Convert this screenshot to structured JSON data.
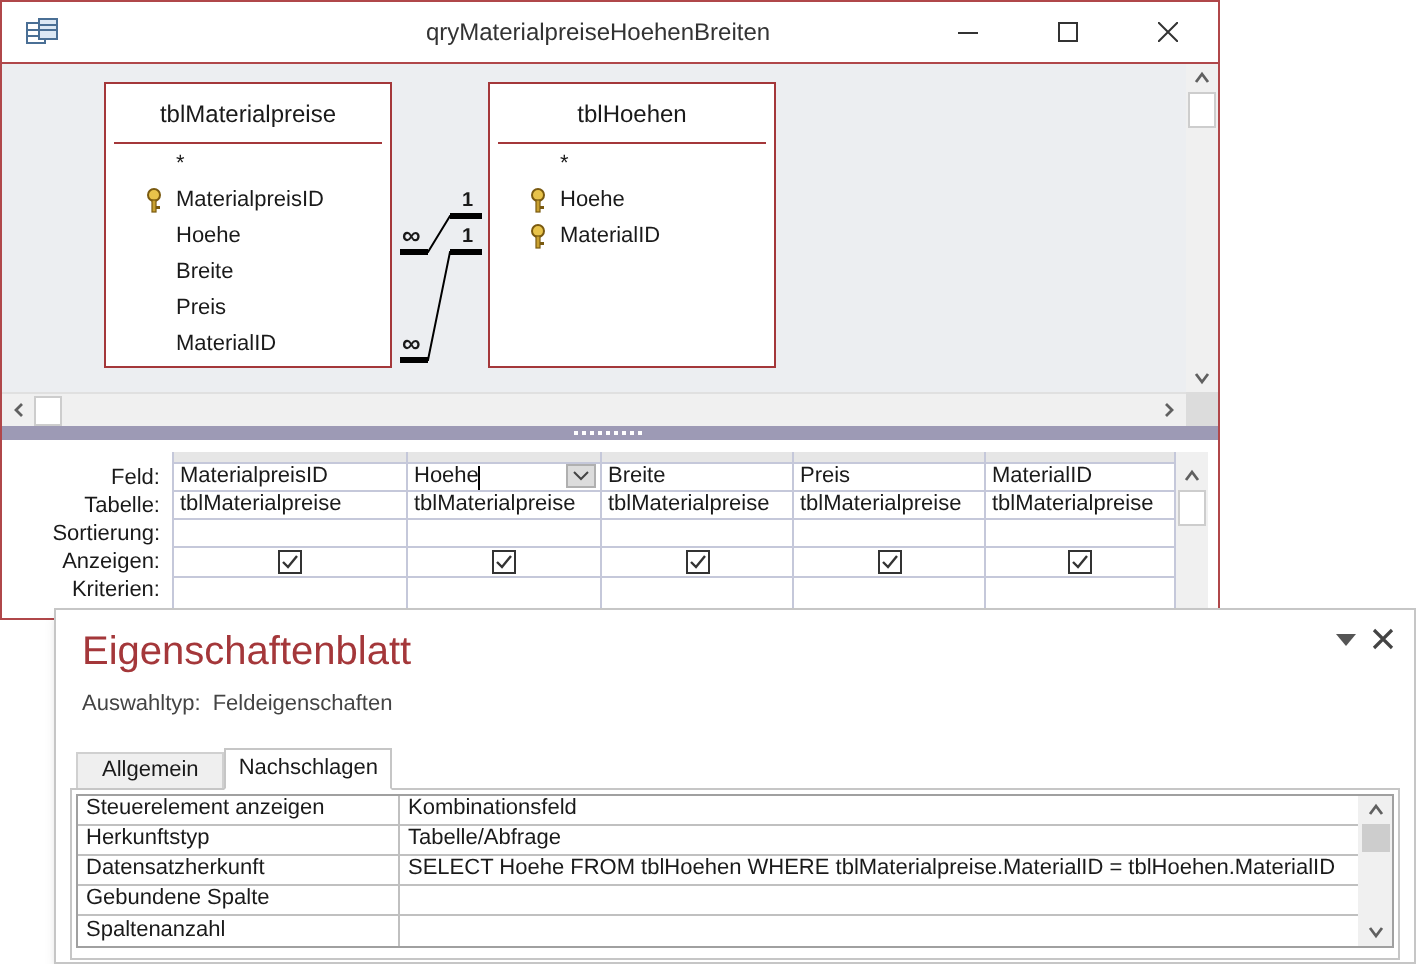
{
  "window": {
    "title": "qryMaterialpreiseHoehenBreiten"
  },
  "diagram": {
    "tables": [
      {
        "name": "tblMaterialpreise",
        "fields": [
          {
            "name": "*",
            "key": false
          },
          {
            "name": "MaterialpreisID",
            "key": true
          },
          {
            "name": "Hoehe",
            "key": false
          },
          {
            "name": "Breite",
            "key": false
          },
          {
            "name": "Preis",
            "key": false
          },
          {
            "name": "MaterialID",
            "key": false
          }
        ]
      },
      {
        "name": "tblHoehen",
        "fields": [
          {
            "name": "*",
            "key": false
          },
          {
            "name": "Hoehe",
            "key": true
          },
          {
            "name": "MaterialID",
            "key": true
          }
        ]
      }
    ],
    "joins": [
      {
        "many": "∞",
        "one": "1"
      },
      {
        "many": "∞",
        "one": "1"
      }
    ]
  },
  "grid": {
    "row_labels": [
      "Feld:",
      "Tabelle:",
      "Sortierung:",
      "Anzeigen:",
      "Kriterien:"
    ],
    "columns": [
      {
        "field": "MaterialpreisID",
        "table": "tblMaterialpreise",
        "show": true,
        "selected": false
      },
      {
        "field": "Hoehe",
        "table": "tblMaterialpreise",
        "show": true,
        "selected": true
      },
      {
        "field": "Breite",
        "table": "tblMaterialpreise",
        "show": true,
        "selected": false
      },
      {
        "field": "Preis",
        "table": "tblMaterialpreise",
        "show": true,
        "selected": false
      },
      {
        "field": "MaterialID",
        "table": "tblMaterialpreise",
        "show": true,
        "selected": false
      }
    ]
  },
  "properties": {
    "title": "Eigenschaftenblatt",
    "selection_type_label": "Auswahltyp:",
    "selection_type": "Feldeigenschaften",
    "tabs": [
      {
        "label": "Allgemein",
        "selected": false
      },
      {
        "label": "Nachschlagen",
        "selected": true
      }
    ],
    "rows": [
      {
        "name": "Steuerelement anzeigen",
        "value": "Kombinationsfeld"
      },
      {
        "name": "Herkunftstyp",
        "value": "Tabelle/Abfrage"
      },
      {
        "name": "Datensatzherkunft",
        "value": "SELECT Hoehe FROM tblHoehen WHERE tblMaterialpreise.MaterialID = tblHoehen.MaterialID"
      },
      {
        "name": "Gebundene Spalte"
      },
      {
        "name": "Spaltenanzahl"
      }
    ]
  }
}
